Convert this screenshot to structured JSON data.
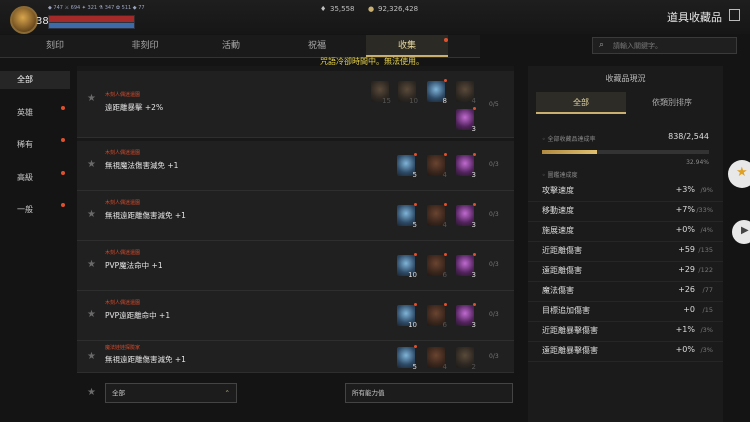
{
  "player": {
    "level": "38",
    "stats": "◆ 747   ⚔ 694  ✦ 321  ⚗ 347  ✿ 511   ◆ 77"
  },
  "currency": {
    "silver": "35,558",
    "gold": "92,326,428"
  },
  "header": {
    "title": "道具收藏品"
  },
  "tabs": [
    {
      "label": "刻印"
    },
    {
      "label": "非刻印"
    },
    {
      "label": "活動"
    },
    {
      "label": "祝福"
    },
    {
      "label": "收集"
    }
  ],
  "search": {
    "placeholder": "請輸入關鍵字。"
  },
  "notice": "咒語冷卻時間中。無法使用。",
  "categories": [
    {
      "label": "全部"
    },
    {
      "label": "英雄"
    },
    {
      "label": "稀有"
    },
    {
      "label": "高級"
    },
    {
      "label": "一般"
    }
  ],
  "rows": [
    {
      "source": "木刻人偶迷還園",
      "name": "遠距離暴擊 +2%",
      "count": "0/5",
      "slots": [
        {
          "num": "15"
        },
        {
          "num": "10"
        },
        {
          "num": "8"
        },
        {
          "num": "4"
        },
        {
          "num": "3"
        }
      ]
    },
    {
      "source": "木刻人偶迷還園",
      "name": "無視魔法傷害減免 +1",
      "count": "0/3",
      "slots": [
        {
          "num": "5"
        },
        {
          "num": "4"
        },
        {
          "num": "3"
        }
      ]
    },
    {
      "source": "木刻人偶迷還園",
      "name": "無視遠距離傷害減免 +1",
      "count": "0/3",
      "slots": [
        {
          "num": "5"
        },
        {
          "num": "4"
        },
        {
          "num": "3"
        }
      ]
    },
    {
      "source": "木刻人偶迷還園",
      "name": "PVP魔法命中 +1",
      "count": "0/3",
      "slots": [
        {
          "num": "10"
        },
        {
          "num": "6"
        },
        {
          "num": "3"
        }
      ]
    },
    {
      "source": "木刻人偶迷還園",
      "name": "PVP遠距離命中 +1",
      "count": "0/3",
      "slots": [
        {
          "num": "10"
        },
        {
          "num": "6"
        },
        {
          "num": "3"
        }
      ]
    },
    {
      "source": "魔法娃娃探險家",
      "name": "無視遠距離傷害減免 +1",
      "count": "0/3",
      "slots": [
        {
          "num": "5"
        },
        {
          "num": "4"
        },
        {
          "num": "2"
        }
      ]
    }
  ],
  "filters": {
    "grade": "全部",
    "ability": "所有能力值"
  },
  "panel": {
    "title": "收藏品現況",
    "tabs": [
      {
        "label": "全部"
      },
      {
        "label": "依類別排序"
      }
    ],
    "completion_label": "全部收藏品達成率",
    "completion_value": "838/2,544",
    "completion_fraction": 0.3294,
    "completion_percent": "32.94%",
    "category_label": "◦ 圖鑑達成度",
    "stats": [
      {
        "label": "攻擊速度",
        "value": "+3%",
        "max": "/9%"
      },
      {
        "label": "移動速度",
        "value": "+7%",
        "max": "/33%"
      },
      {
        "label": "施展速度",
        "value": "+0%",
        "max": "/4%"
      },
      {
        "label": "近距離傷害",
        "value": "+59",
        "max": "/135"
      },
      {
        "label": "遠距離傷害",
        "value": "+29",
        "max": "/122"
      },
      {
        "label": "魔法傷害",
        "value": "+26",
        "max": "/77"
      },
      {
        "label": "目標追加傷害",
        "value": "+0",
        "max": "/15"
      },
      {
        "label": "近距離暴擊傷害",
        "value": "+1%",
        "max": "/3%"
      },
      {
        "label": "遠距離暴擊傷害",
        "value": "+0%",
        "max": "/3%"
      }
    ]
  },
  "colors": {
    "accent": "#c9b071",
    "notice": "#e8d44a",
    "alert_dot": "#e0502c"
  }
}
